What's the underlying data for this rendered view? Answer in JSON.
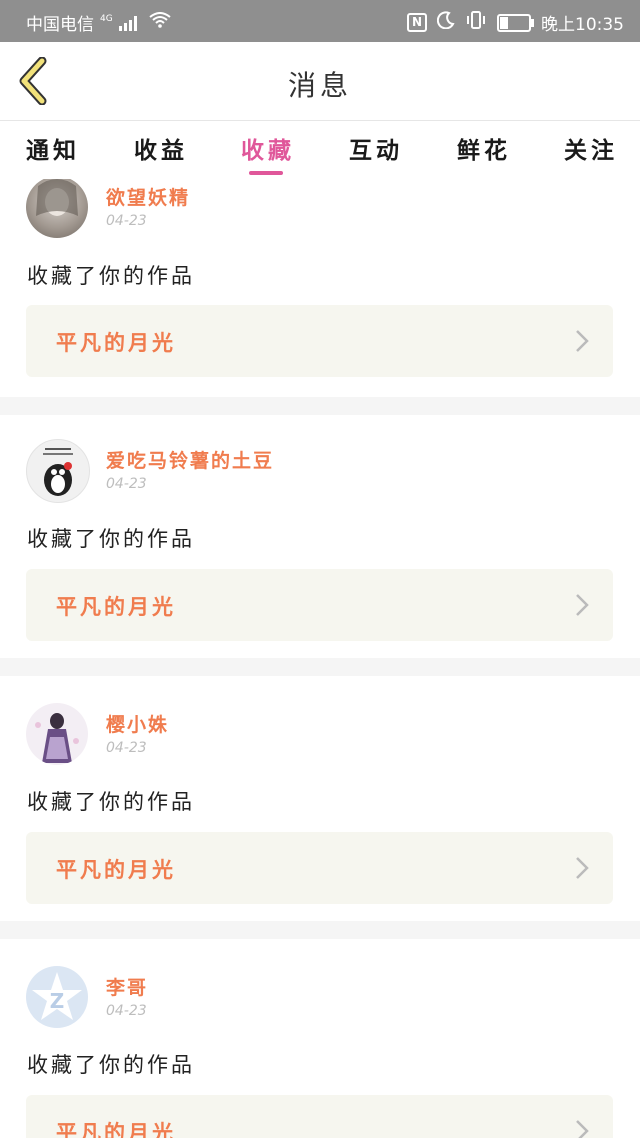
{
  "status_bar": {
    "carrier": "中国电信",
    "network": "4G",
    "time": "晚上10:35",
    "battery_level": 0.3,
    "icons": [
      "signal-icon",
      "wifi-icon",
      "nfc-icon",
      "moon-icon",
      "vibrate-icon",
      "battery-icon"
    ]
  },
  "header": {
    "title": "消息",
    "back_icon": "chevron-left-icon"
  },
  "tabs": [
    {
      "label": "通知",
      "active": false
    },
    {
      "label": "收益",
      "active": false
    },
    {
      "label": "收藏",
      "active": true
    },
    {
      "label": "互动",
      "active": false
    },
    {
      "label": "鲜花",
      "active": false
    },
    {
      "label": "关注",
      "active": false
    }
  ],
  "colors": {
    "accent": "#e0579a",
    "username": "#f07c4e",
    "work_box": "#f6f6ef"
  },
  "items": [
    {
      "user": "欲望妖精",
      "date": "04-23",
      "action": "收藏了你的作品",
      "work": "平凡的月光"
    },
    {
      "user": "爱吃马铃薯的土豆",
      "date": "04-23",
      "action": "收藏了你的作品",
      "work": "平凡的月光"
    },
    {
      "user": "樱小姝",
      "date": "04-23",
      "action": "收藏了你的作品",
      "work": "平凡的月光"
    },
    {
      "user": "李哥",
      "date": "04-23",
      "action": "收藏了你的作品",
      "work": "平凡的月光"
    }
  ]
}
